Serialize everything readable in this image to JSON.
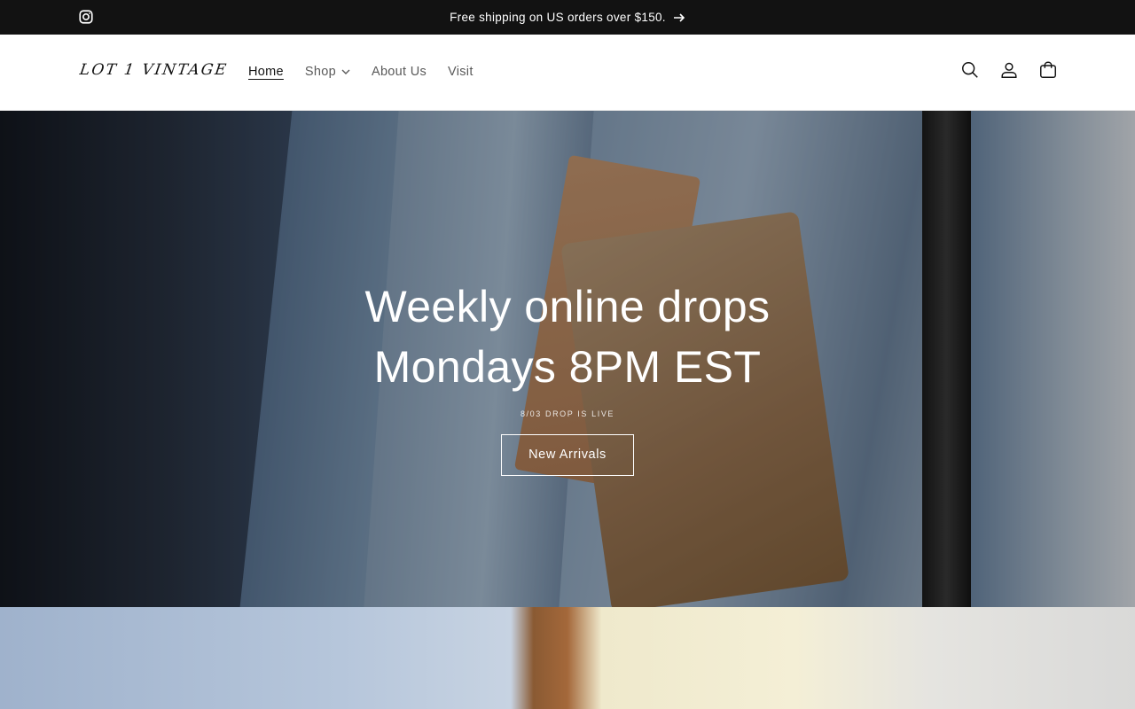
{
  "announcement": {
    "text": "Free shipping on US orders over $150."
  },
  "header": {
    "logo_text": "LOT 1 VINTAGE",
    "nav": [
      {
        "label": "Home",
        "active": true
      },
      {
        "label": "Shop",
        "has_dropdown": true
      },
      {
        "label": "About Us"
      },
      {
        "label": "Visit"
      }
    ],
    "icons": [
      "search-icon",
      "account-icon",
      "cart-icon"
    ]
  },
  "hero": {
    "title_line1": "Weekly online drops",
    "title_line2": "Mondays 8PM EST",
    "subtitle": "8/03 DROP IS LIVE",
    "button_label": "New Arrivals"
  },
  "colors": {
    "announcement_bg": "#121212",
    "text": "#121212",
    "nav_muted": "#5a5a5a",
    "white": "#ffffff"
  }
}
